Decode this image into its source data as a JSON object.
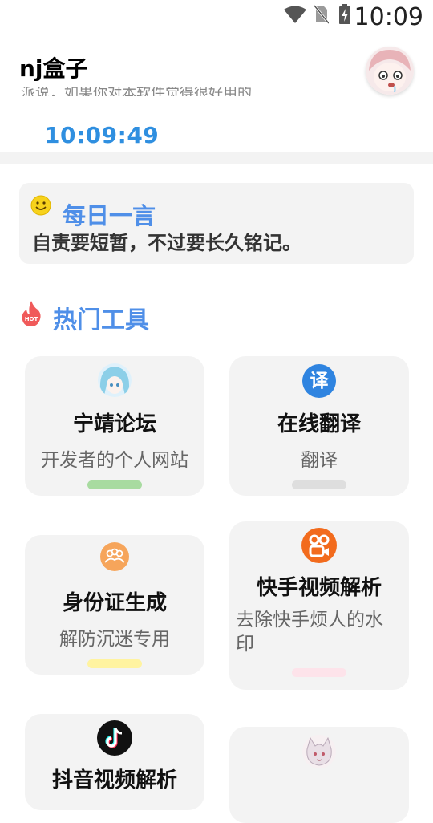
{
  "status_bar": {
    "time": "10:09",
    "icons": [
      "wifi-icon",
      "no-sim-icon",
      "battery-charging-icon"
    ]
  },
  "header": {
    "title": "nj盒子",
    "subtitle": "派说，如果你对本软件觉得很好用的",
    "avatar_icon": "anime-avatar-icon",
    "clock": "10:09:49"
  },
  "daily_quote": {
    "title": "每日一言",
    "text": "自责要短暂，不过要长久铭记。",
    "icon": "smile-icon"
  },
  "hot_tools": {
    "title": "热门工具",
    "icon": "hot-flame-icon",
    "items": [
      {
        "name": "宁靖论坛",
        "desc": "开发者的个人网站",
        "icon": "anime-girl-icon",
        "pill_color": "#a8dba0"
      },
      {
        "name": "在线翻译",
        "desc": "翻译",
        "icon": "translate-icon",
        "icon_text": "译",
        "pill_color": "#dedede"
      },
      {
        "name": "身份证生成",
        "desc": "解防沉迷专用",
        "icon": "users-icon",
        "pill_color": "#fff3a0"
      },
      {
        "name": "快手视频解析",
        "desc": "去除快手烦人的水印",
        "icon": "kuaishou-icon",
        "pill_color": "#fde3ea"
      },
      {
        "name": "抖音视频解析",
        "desc": "",
        "icon": "tiktok-icon",
        "pill_color": ""
      },
      {
        "name": "",
        "desc": "",
        "icon": "anime-character-icon",
        "pill_color": ""
      }
    ]
  },
  "colors": {
    "accent_blue": "#4f8fe8",
    "clock_blue": "#2f8fe0",
    "card_bg": "#f3f3f3"
  }
}
